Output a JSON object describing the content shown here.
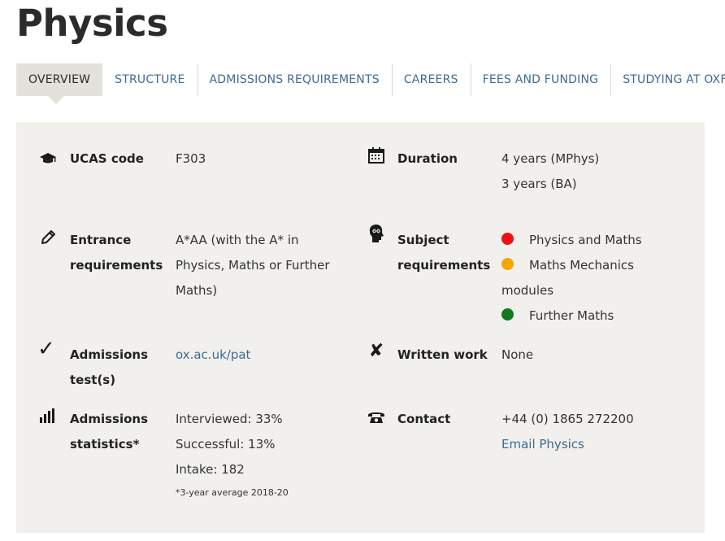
{
  "page": {
    "title": "Physics"
  },
  "tabs": [
    {
      "label": "OVERVIEW",
      "active": true
    },
    {
      "label": "STRUCTURE"
    },
    {
      "label": "ADMISSIONS REQUIREMENTS"
    },
    {
      "label": "CAREERS"
    },
    {
      "label": "FEES AND FUNDING"
    },
    {
      "label": "STUDYING AT OXFORD"
    }
  ],
  "overview": {
    "ucas": {
      "icon": "graduation-cap-icon",
      "label": "UCAS code",
      "value": "F303"
    },
    "duration": {
      "icon": "calendar-icon",
      "label": "Duration",
      "lines": [
        "4 years (MPhys)",
        "3 years (BA)"
      ]
    },
    "entrance": {
      "icon": "pencil-icon",
      "label_line1": "Entrance",
      "label_line2": "requirements",
      "value": "A*AA (with the A* in Physics, Maths or Further Maths)"
    },
    "subject": {
      "icon": "head-icon",
      "label_line1": "Subject",
      "label_line2": "requirements",
      "items": [
        {
          "text": "Physics and Maths",
          "color": "#ee1111"
        },
        {
          "text": "Maths Mechanics modules",
          "color": "#f7a600"
        },
        {
          "text": "Further Maths",
          "color": "#0f7a1f"
        }
      ]
    },
    "test": {
      "icon": "checkmark-icon",
      "label_line1": "Admissions",
      "label_line2": "test(s)",
      "value": "ox.ac.uk/pat"
    },
    "written": {
      "icon": "cross-icon",
      "label": "Written work",
      "value": "None"
    },
    "stats": {
      "icon": "signal-bars-icon",
      "label_line1": "Admissions",
      "label_line2": "statistics*",
      "interviewed": "Interviewed: 33%",
      "successful": "Successful: 13%",
      "intake": "Intake: 182",
      "note": "*3-year average 2018-20"
    },
    "contact": {
      "icon": "telephone-icon",
      "label": "Contact",
      "phone": "+44 (0) 1865 272200",
      "email": "Email Physics"
    }
  }
}
